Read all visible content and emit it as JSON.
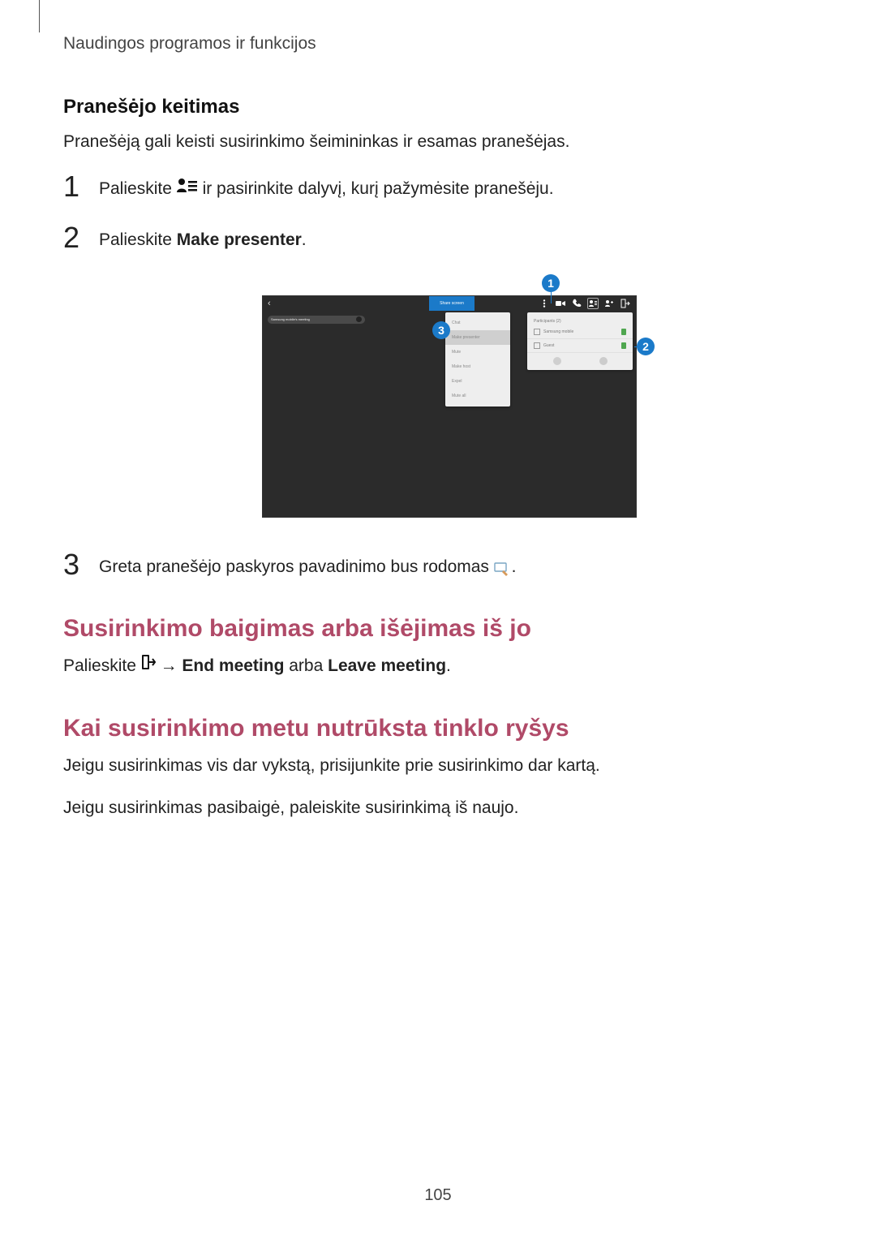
{
  "running_header": "Naudingos programos ir funkcijos",
  "section1": {
    "title": "Pranešėjo keitimas",
    "intro": "Pranešėją gali keisti susirinkimo šeimininkas ir esamas pranešėjas.",
    "step1_pre": "Palieskite ",
    "step1_post": " ir pasirinkite dalyvį, kurį pažymėsite pranešėju.",
    "step2_pre": "Palieskite ",
    "step2_bold": "Make presenter",
    "step2_post": ".",
    "step3_pre": "Greta pranešėjo paskyros pavadinimo bus rodomas ",
    "step3_post": "."
  },
  "figure": {
    "callout1": "1",
    "callout2": "2",
    "callout3": "3",
    "share_label": "Share screen",
    "pill_label": "Samsung mobile's meeting",
    "dropdown": [
      "Chat",
      "Make presenter",
      "Mute",
      "Make host",
      "Expel",
      "Mute all"
    ],
    "panel_header": "Participants (2)",
    "panel_row1": "Samsung mobile",
    "panel_row2": "Guest"
  },
  "section2": {
    "title": "Susirinkimo baigimas arba išėjimas iš jo",
    "body_pre": "Palieskite ",
    "body_arrow": "→",
    "body_bold1": "End meeting",
    "body_mid": " arba ",
    "body_bold2": "Leave meeting",
    "body_post": "."
  },
  "section3": {
    "title": "Kai susirinkimo metu nutrūksta tinklo ryšys",
    "p1": "Jeigu susirinkimas vis dar vykstą, prisijunkite prie susirinkimo dar kartą.",
    "p2": "Jeigu susirinkimas pasibaigė, paleiskite susirinkimą iš naujo."
  },
  "page_number": "105"
}
